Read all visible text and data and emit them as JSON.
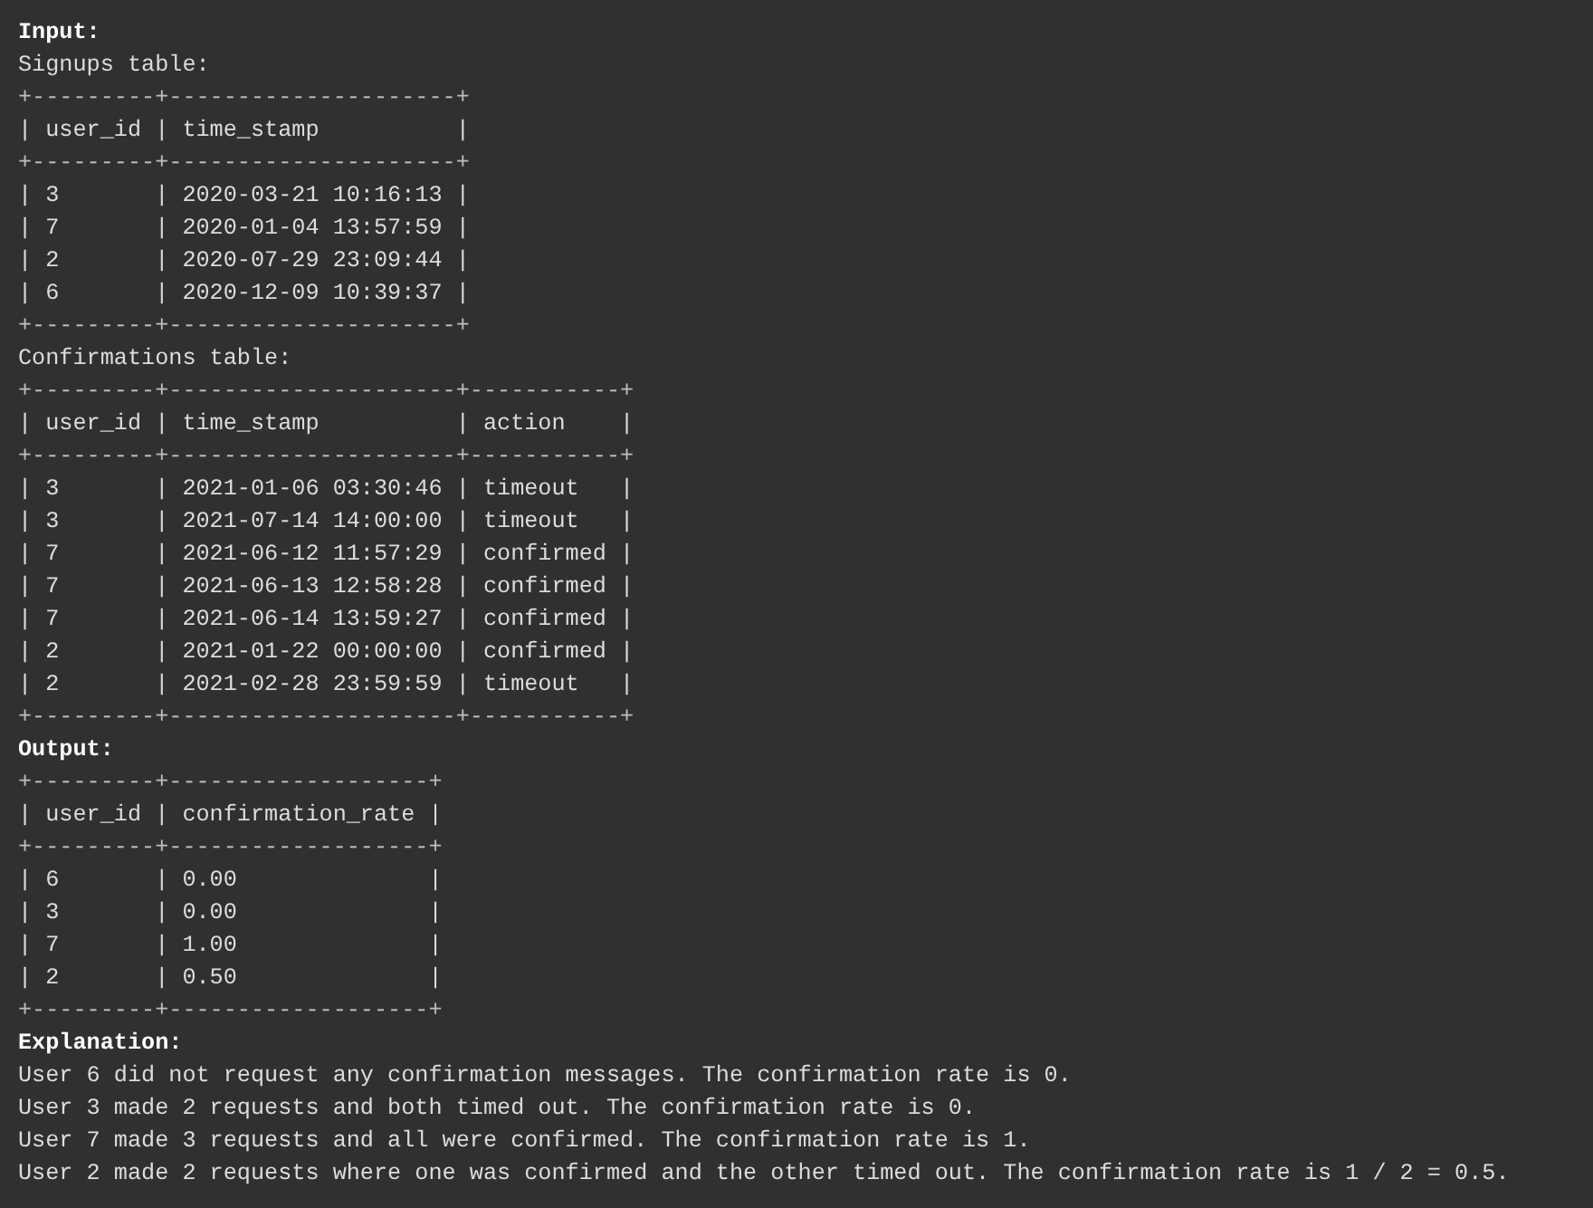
{
  "lines": [
    {
      "kind": "heading",
      "text": "Input:"
    },
    {
      "kind": "caption",
      "text": "Signups table:"
    },
    {
      "kind": "border",
      "text": "+---------+---------------------+"
    },
    {
      "kind": "row",
      "text": "| user_id | time_stamp          |"
    },
    {
      "kind": "border",
      "text": "+---------+---------------------+"
    },
    {
      "kind": "row",
      "text": "| 3       | 2020-03-21 10:16:13 |"
    },
    {
      "kind": "row",
      "text": "| 7       | 2020-01-04 13:57:59 |"
    },
    {
      "kind": "row",
      "text": "| 2       | 2020-07-29 23:09:44 |"
    },
    {
      "kind": "row",
      "text": "| 6       | 2020-12-09 10:39:37 |"
    },
    {
      "kind": "border",
      "text": "+---------+---------------------+"
    },
    {
      "kind": "caption",
      "text": "Confirmations table:"
    },
    {
      "kind": "border",
      "text": "+---------+---------------------+-----------+"
    },
    {
      "kind": "row",
      "text": "| user_id | time_stamp          | action    |"
    },
    {
      "kind": "border",
      "text": "+---------+---------------------+-----------+"
    },
    {
      "kind": "row",
      "text": "| 3       | 2021-01-06 03:30:46 | timeout   |"
    },
    {
      "kind": "row",
      "text": "| 3       | 2021-07-14 14:00:00 | timeout   |"
    },
    {
      "kind": "row",
      "text": "| 7       | 2021-06-12 11:57:29 | confirmed |"
    },
    {
      "kind": "row",
      "text": "| 7       | 2021-06-13 12:58:28 | confirmed |"
    },
    {
      "kind": "row",
      "text": "| 7       | 2021-06-14 13:59:27 | confirmed |"
    },
    {
      "kind": "row",
      "text": "| 2       | 2021-01-22 00:00:00 | confirmed |"
    },
    {
      "kind": "row",
      "text": "| 2       | 2021-02-28 23:59:59 | timeout   |"
    },
    {
      "kind": "border",
      "text": "+---------+---------------------+-----------+"
    },
    {
      "kind": "heading",
      "text": "Output:"
    },
    {
      "kind": "border",
      "text": "+---------+-------------------+"
    },
    {
      "kind": "row",
      "text": "| user_id | confirmation_rate |"
    },
    {
      "kind": "border",
      "text": "+---------+-------------------+"
    },
    {
      "kind": "row",
      "text": "| 6       | 0.00              |"
    },
    {
      "kind": "row",
      "text": "| 3       | 0.00              |"
    },
    {
      "kind": "row",
      "text": "| 7       | 1.00              |"
    },
    {
      "kind": "row",
      "text": "| 2       | 0.50              |"
    },
    {
      "kind": "border",
      "text": "+---------+-------------------+"
    },
    {
      "kind": "heading",
      "text": "Explanation:"
    },
    {
      "kind": "caption",
      "text": "User 6 did not request any confirmation messages. The confirmation rate is 0."
    },
    {
      "kind": "caption",
      "text": "User 3 made 2 requests and both timed out. The confirmation rate is 0."
    },
    {
      "kind": "caption",
      "text": "User 7 made 3 requests and all were confirmed. The confirmation rate is 1."
    },
    {
      "kind": "caption",
      "text": "User 2 made 2 requests where one was confirmed and the other timed out. The confirmation rate is 1 / 2 = 0.5."
    }
  ]
}
